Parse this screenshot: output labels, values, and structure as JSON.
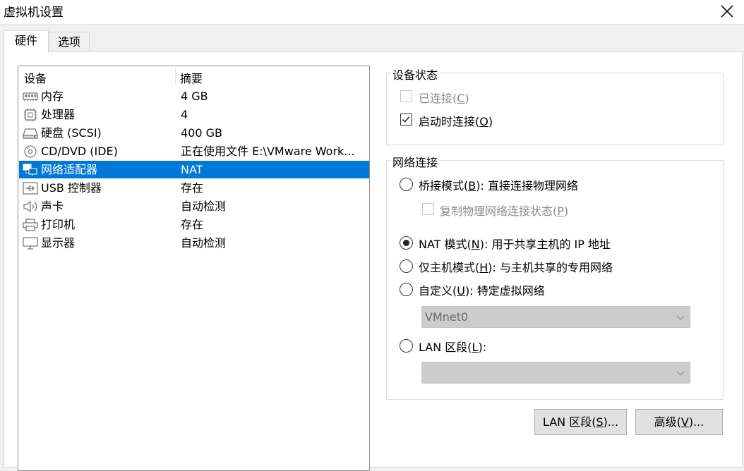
{
  "window": {
    "title": "虚拟机设置",
    "close_icon": "close-icon"
  },
  "tabs": [
    {
      "label": "硬件",
      "active": true
    },
    {
      "label": "选项",
      "active": false
    }
  ],
  "device_list": {
    "headers": {
      "device": "设备",
      "summary": "摘要"
    },
    "rows": [
      {
        "icon": "memory-icon",
        "name": "内存",
        "summary": "4 GB"
      },
      {
        "icon": "processor-icon",
        "name": "处理器",
        "summary": "4"
      },
      {
        "icon": "hard-disk-icon",
        "name": "硬盘 (SCSI)",
        "summary": "400 GB"
      },
      {
        "icon": "cd-dvd-icon",
        "name": "CD/DVD (IDE)",
        "summary": "正在使用文件 E:\\VMware Work..."
      },
      {
        "icon": "network-adapter-icon",
        "name": "网络适配器",
        "summary": "NAT",
        "selected": true
      },
      {
        "icon": "usb-icon",
        "name": "USB 控制器",
        "summary": "存在"
      },
      {
        "icon": "sound-icon",
        "name": "声卡",
        "summary": "自动检测"
      },
      {
        "icon": "printer-icon",
        "name": "打印机",
        "summary": "存在"
      },
      {
        "icon": "display-icon",
        "name": "显示器",
        "summary": "自动检测"
      }
    ]
  },
  "device_status": {
    "legend": "设备状态",
    "connected": {
      "label_pre": "已连接(",
      "key": "C",
      "label_post": ")",
      "checked": false,
      "enabled": false
    },
    "connect_at_power_on": {
      "label_pre": "启动时连接(",
      "key": "O",
      "label_post": ")",
      "checked": true,
      "enabled": true
    }
  },
  "network_connection": {
    "legend": "网络连接",
    "bridged": {
      "label_pre": "桥接模式(",
      "key": "B",
      "label_post": "): 直接连接物理网络",
      "selected": false
    },
    "replicate": {
      "label_pre": "复制物理网络连接状态(",
      "key": "P",
      "label_post": ")",
      "checked": false,
      "enabled": false
    },
    "nat": {
      "label_pre": "NAT 模式(",
      "key": "N",
      "label_post": "): 用于共享主机的 IP 地址",
      "selected": true
    },
    "host_only": {
      "label_pre": "仅主机模式(",
      "key": "H",
      "label_post": "): 与主机共享的专用网络",
      "selected": false
    },
    "custom": {
      "label_pre": "自定义(",
      "key": "U",
      "label_post": "): 特定虚拟网络",
      "selected": false
    },
    "custom_select": {
      "value": "VMnet0"
    },
    "lan_segment": {
      "label_pre": "LAN 区段(",
      "key": "L",
      "label_post": "):",
      "selected": false
    },
    "lan_select": {
      "value": ""
    }
  },
  "buttons": {
    "lan_segments": {
      "label_pre": "LAN 区段(",
      "key": "S",
      "label_post": ")..."
    },
    "advanced": {
      "label_pre": "高级(",
      "key": "V",
      "label_post": ")..."
    }
  },
  "colors": {
    "selection": "#0078d7",
    "panel": "#ffffff",
    "background": "#f0f0f0"
  }
}
